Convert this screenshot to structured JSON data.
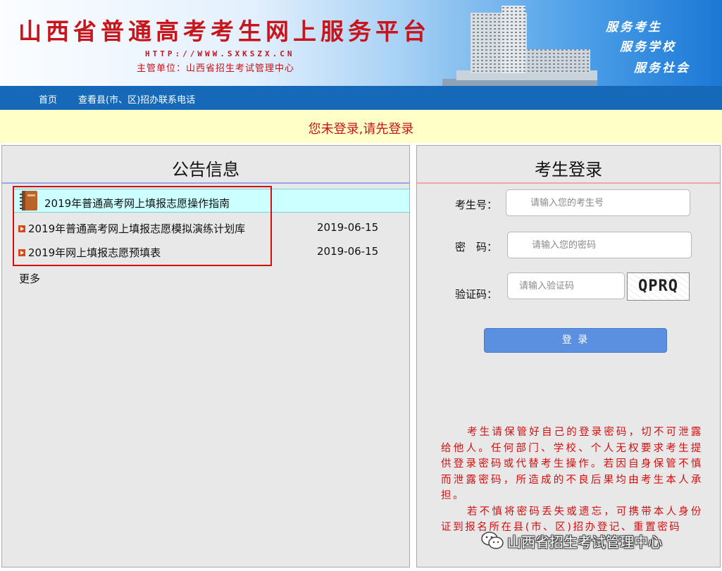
{
  "header": {
    "title": "山西省普通高考考生网上服务平台",
    "url": "HTTP://WWW.SXKSZX.CN",
    "org": "主管单位：山西省招生考试管理中心",
    "slogans": [
      "服务考生",
      "服务学校",
      "服务社会"
    ]
  },
  "nav": {
    "items": [
      "首页",
      "查看县(市、区)招办联系电话"
    ]
  },
  "notice": "您未登录,请先登录",
  "announcements": {
    "title": "公告信息",
    "items": [
      {
        "title": "2019年普通高考网上填报志愿操作指南",
        "date": ""
      },
      {
        "title": "2019年普通高考网上填报志愿模拟演练计划库",
        "date": "2019-06-15"
      },
      {
        "title": "2019年网上填报志愿预填表",
        "date": "2019-06-15"
      }
    ],
    "more": "更多"
  },
  "login": {
    "title": "考生登录",
    "candidate_label": "考生号：",
    "candidate_placeholder": "请输入您的考生号",
    "password_label": "密　码：",
    "password_placeholder": "请输入您的密码",
    "captcha_label": "验证码：",
    "captcha_placeholder": "请输入验证码",
    "captcha_text": "QPRQ",
    "submit": "登 录",
    "warning_p1": "考生请保管好自己的登录密码，切不可泄露给他人。任何部门、学校、个人无权要求考生提供登录密码或代替考生操作。若因自身保管不慎而泄露密码，所造成的不良后果均由考生本人承担。",
    "warning_p2": "若不慎将密码丢失或遗忘，可携带本人身份证到报名所在县(市、区)招办登记、重置密码"
  },
  "watermark": "山西省招生考试管理中心",
  "colors": {
    "nav_bg": "#1668b8",
    "notice_bg": "#ffffc8",
    "accent_red": "#c8141b",
    "highlight_row": "#ccffff",
    "button": "#5b8fe0"
  }
}
